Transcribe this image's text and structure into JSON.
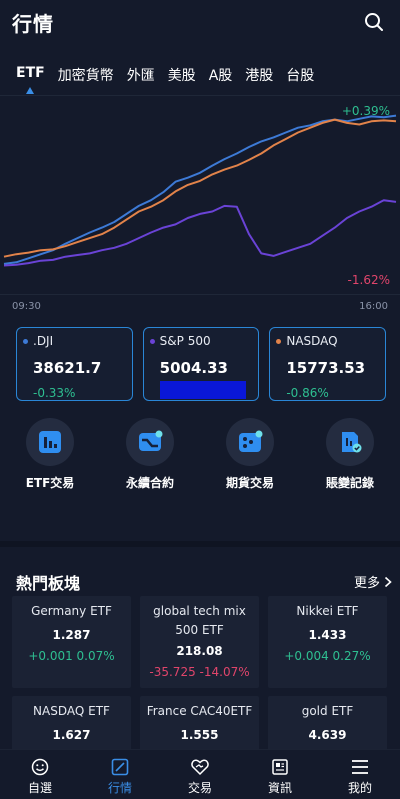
{
  "header": {
    "title": "行情"
  },
  "tabs": [
    {
      "label": "ETF",
      "active": true
    },
    {
      "label": "加密貨幣",
      "active": false
    },
    {
      "label": "外匯",
      "active": false
    },
    {
      "label": "美股",
      "active": false
    },
    {
      "label": "A股",
      "active": false
    },
    {
      "label": "港股",
      "active": false
    },
    {
      "label": "台股",
      "active": false
    }
  ],
  "chart": {
    "max_pct": "+0.39%",
    "min_pct": "-1.62%",
    "start_time": "09:30",
    "end_time": "16:00"
  },
  "chart_data": {
    "type": "line",
    "ylim": [
      -1.62,
      0.39
    ],
    "series": [
      {
        "color": "#3d7ad6",
        "values": [
          -1.47,
          -1.45,
          -1.4,
          -1.35,
          -1.3,
          -1.22,
          -1.15,
          -1.08,
          -1.02,
          -0.95,
          -0.85,
          -0.75,
          -0.68,
          -0.58,
          -0.45,
          -0.4,
          -0.34,
          -0.25,
          -0.17,
          -0.1,
          -0.02,
          0.05,
          0.1,
          0.16,
          0.22,
          0.25,
          0.3,
          0.32,
          0.3,
          0.33,
          0.36,
          0.35,
          0.37
        ]
      },
      {
        "color": "#e2834a",
        "values": [
          -1.38,
          -1.35,
          -1.33,
          -1.3,
          -1.29,
          -1.25,
          -1.2,
          -1.15,
          -1.1,
          -1.02,
          -0.92,
          -0.82,
          -0.76,
          -0.68,
          -0.57,
          -0.49,
          -0.44,
          -0.36,
          -0.3,
          -0.25,
          -0.18,
          -0.1,
          0.0,
          0.08,
          0.16,
          0.22,
          0.28,
          0.32,
          0.28,
          0.26,
          0.3,
          0.31,
          0.3
        ]
      },
      {
        "color": "#6a43d6",
        "values": [
          -1.49,
          -1.48,
          -1.46,
          -1.43,
          -1.42,
          -1.38,
          -1.36,
          -1.34,
          -1.3,
          -1.27,
          -1.22,
          -1.15,
          -1.08,
          -1.02,
          -0.98,
          -0.9,
          -0.85,
          -0.82,
          -0.75,
          -0.76,
          -1.1,
          -1.34,
          -1.37,
          -1.32,
          -1.27,
          -1.22,
          -1.12,
          -1.02,
          -0.9,
          -0.82,
          -0.76,
          -0.68,
          -0.7
        ]
      }
    ]
  },
  "indices": [
    {
      "name": ".DJI",
      "value": "38621.7",
      "change": "-0.33%",
      "dot_color": "#3d7ad6"
    },
    {
      "name": "S&P 500",
      "value": "5004.33",
      "change": "",
      "dot_color": "#6a43d6"
    },
    {
      "name": "NASDAQ",
      "value": "15773.53",
      "change": "-0.86%",
      "dot_color": "#e2834a"
    }
  ],
  "shortcuts": [
    {
      "label": "ETF交易",
      "icon": "bar-chart-icon"
    },
    {
      "label": "永續合約",
      "icon": "trend-chart-icon"
    },
    {
      "label": "期貨交易",
      "icon": "dice-chart-icon"
    },
    {
      "label": "賬變記錄",
      "icon": "record-icon"
    }
  ],
  "hot": {
    "title": "熱門板塊",
    "more_label": "更多",
    "items": [
      {
        "name": "Germany ETF",
        "price": "1.287",
        "change": "+0.001  0.07%",
        "direction": "pos"
      },
      {
        "name": "global tech mix 500 ETF",
        "price": "218.08",
        "change": "-35.725  -14.07%",
        "direction": "neg"
      },
      {
        "name": "Nikkei ETF",
        "price": "1.433",
        "change": "+0.004  0.27%",
        "direction": "pos"
      },
      {
        "name": "NASDAQ ETF",
        "price": "1.627",
        "change": "",
        "direction": "pos"
      },
      {
        "name": "France CAC40ETF",
        "price": "1.555",
        "change": "",
        "direction": "neg"
      },
      {
        "name": "gold ETF",
        "price": "4.639",
        "change": "",
        "direction": "pos"
      }
    ]
  },
  "nav": [
    {
      "label": "自選",
      "icon": "smile-icon",
      "active": false
    },
    {
      "label": "行情",
      "icon": "chart-box-icon",
      "active": true
    },
    {
      "label": "交易",
      "icon": "handshake-icon",
      "active": false
    },
    {
      "label": "資訊",
      "icon": "news-icon",
      "active": false
    },
    {
      "label": "我的",
      "icon": "menu-icon",
      "active": false
    }
  ]
}
